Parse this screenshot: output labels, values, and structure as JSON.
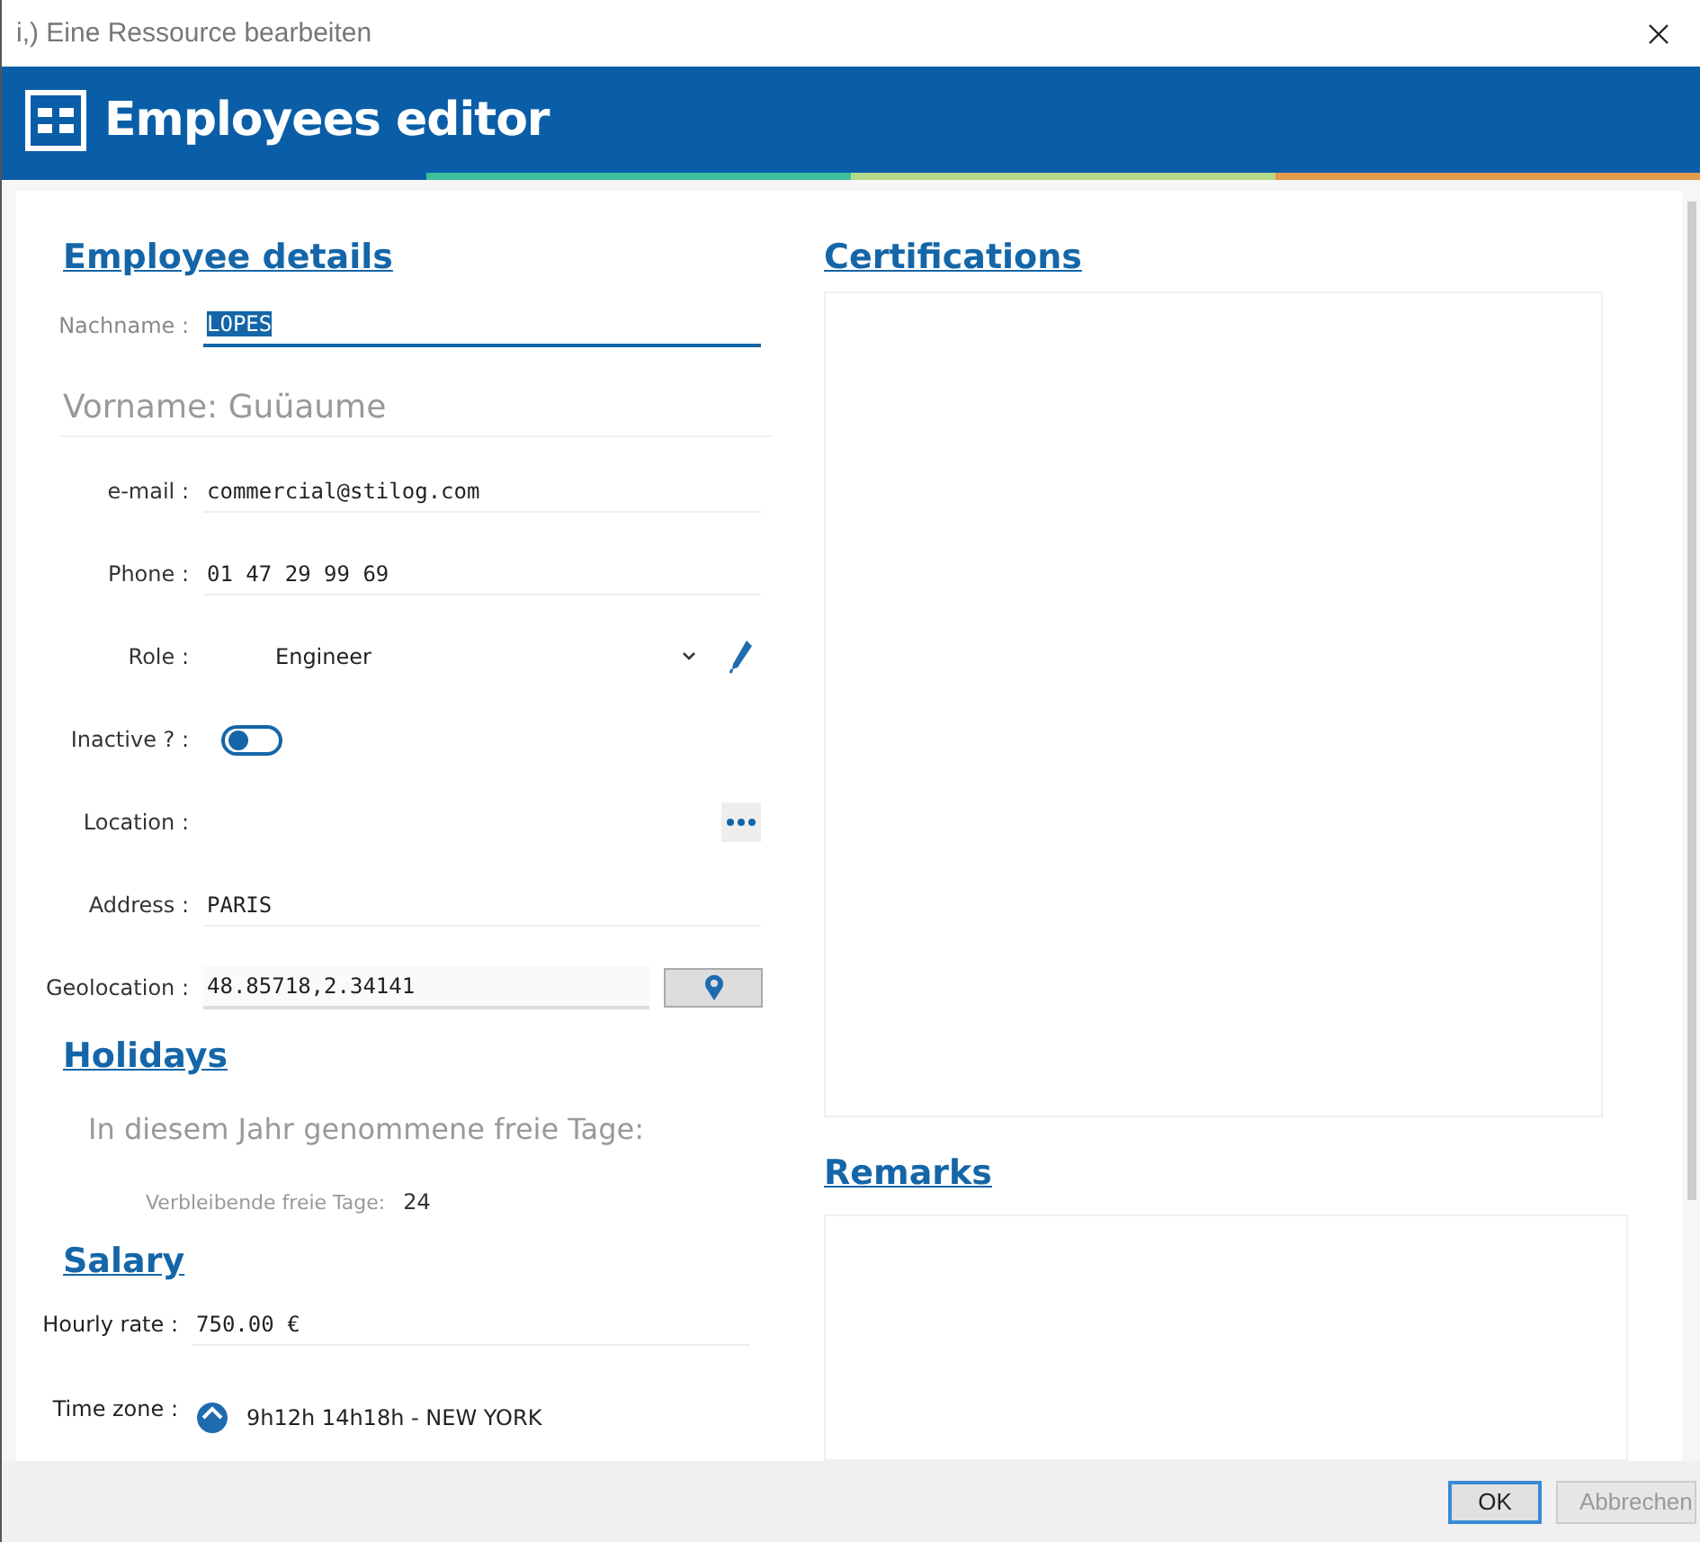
{
  "window": {
    "title": "i,) Eine Ressource bearbeiten"
  },
  "header": {
    "title": "Employees editor"
  },
  "employee_details": {
    "heading": "Employee details",
    "fields": [
      {
        "kind": "text",
        "label": "Nachname :",
        "value": "LOPES",
        "focused": true
      },
      {
        "kind": "placeholder",
        "placeholder": "Vorname: Guüaume"
      },
      {
        "kind": "text",
        "label": "e-mail :",
        "value": "commercial@stilog.com",
        "focused": false
      },
      {
        "kind": "text",
        "label": "Phone :",
        "value": "01 47 29 99 69",
        "focused": false
      },
      {
        "kind": "select",
        "label": "Role :",
        "value": "Engineer"
      },
      {
        "kind": "toggle",
        "label": "Inactive ? :",
        "on": false
      },
      {
        "kind": "picker",
        "label": "Location :"
      },
      {
        "kind": "text",
        "label": "Address :",
        "value": "PARIS",
        "focused": false
      },
      {
        "kind": "geo",
        "label": "Geolocation :",
        "value": "48.85718,2.34141"
      }
    ]
  },
  "holidays": {
    "heading": "Holidays",
    "taken_label": "In diesem Jahr genommene freie Tage:",
    "remaining_label": "Verbleibende freie Tage:",
    "remaining_value": "24"
  },
  "salary": {
    "heading": "Salary",
    "fields": [
      {
        "kind": "text",
        "label": "Hourly rate :",
        "value": "750.00 €",
        "focused": false
      },
      {
        "kind": "timezone",
        "label": "Time zone :",
        "value": "9h12h 14h18h - NEW YORK"
      }
    ]
  },
  "certifications": {
    "heading": "Certifications"
  },
  "remarks": {
    "heading": "Remarks"
  },
  "buttons": [
    {
      "label": "OK",
      "kind": "default"
    },
    {
      "label": "Abbrechen",
      "kind": "disabled"
    }
  ]
}
